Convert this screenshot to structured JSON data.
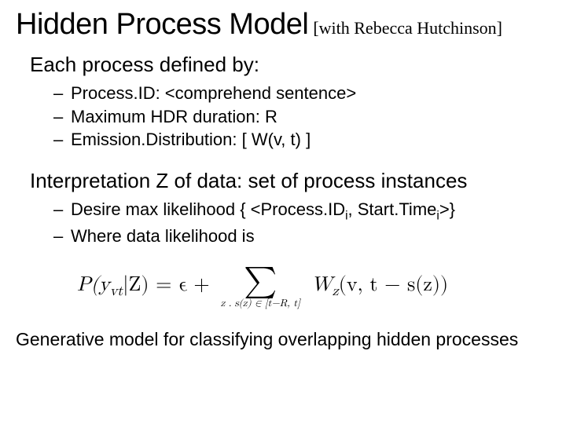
{
  "title": "Hidden Process Model",
  "attribution": "[with Rebecca Hutchinson]",
  "section1_heading": "Each process defined by:",
  "section1_items": [
    "Process.ID: <comprehend sentence>",
    "Maximum HDR duration: R",
    "Emission.Distribution: [ W(v, t) ]"
  ],
  "section2_heading": "Interpretation Z of data: set of process instances",
  "section2_item1_prefix": "Desire max likelihood { <Process.ID",
  "section2_item1_sub1": "i",
  "section2_item1_mid": ", Start.Time",
  "section2_item1_sub2": "i",
  "section2_item1_suffix": ">}",
  "section2_item2": "Where data likelihood is",
  "formula": {
    "lhs": "P(y",
    "lhs_sub": "vt",
    "lhs_mid": "|Z) = ϵ +",
    "sum_limits": "z . s(z) ∈ [t−R, t]",
    "rhs": "W",
    "rhs_sub": "z",
    "rhs_tail": "(v, t − s(z))"
  },
  "footer": "Generative model for classifying overlapping hidden processes"
}
